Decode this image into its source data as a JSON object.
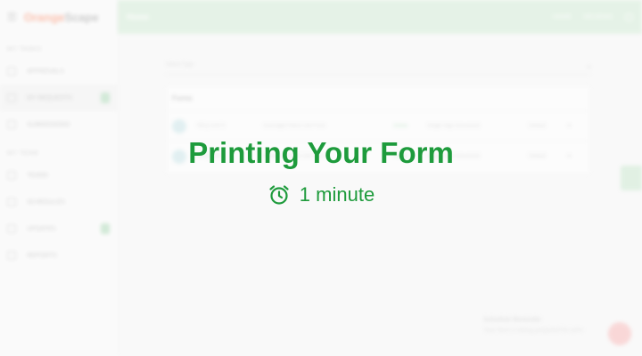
{
  "overlay": {
    "title": "Printing Your Form",
    "duration": "1 minute",
    "icon": "alarm-clock-icon",
    "color": "#1e9b3c"
  },
  "brand": {
    "name_part1": "Orange",
    "name_part2": "Scape",
    "accent": "#ff6b3d"
  },
  "sidebar": {
    "section1": "MY TASKS",
    "items1": [
      {
        "label": "APPROVALS"
      },
      {
        "label": "MY REQUESTS",
        "active": true
      },
      {
        "label": "SUBMISSIONS"
      }
    ],
    "section2": "MY TEAM",
    "items2": [
      {
        "label": "TEAMS"
      },
      {
        "label": "SCHEDULES"
      },
      {
        "label": "UPDATES"
      },
      {
        "label": "REPORTS"
      }
    ]
  },
  "topbar": {
    "title": "Home",
    "link1": "HOME",
    "link2": "REVIEWS",
    "color": "#c8e8cc"
  },
  "main": {
    "filter_placeholder": "Select Type",
    "card_title": "Forms",
    "rows": [
      {
        "id": "REQ-10472",
        "name": "Overnight Patrol Job Form",
        "status": "Active",
        "type": "Single Sign Document",
        "owner": "Default"
      },
      {
        "id": "REQ-10473",
        "name": "Weekend Patrol Job Form",
        "status": "Active",
        "type": "Single Sign Document",
        "owner": "Default"
      }
    ],
    "note_title": "Schedule Reminder",
    "note_text": "Your form is being prepared for print"
  }
}
